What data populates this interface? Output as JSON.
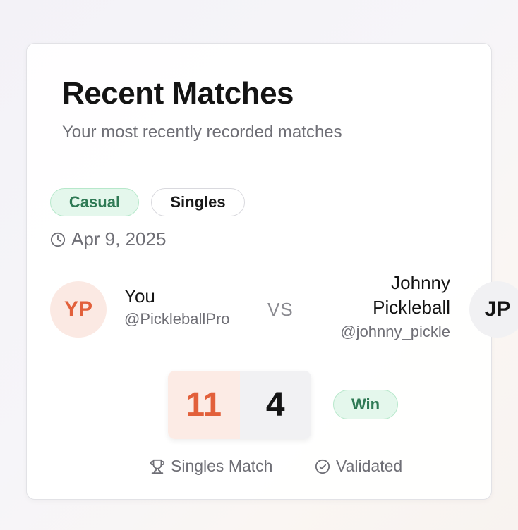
{
  "header": {
    "title": "Recent Matches",
    "subtitle": "Your most recently recorded matches"
  },
  "match": {
    "tags": [
      {
        "label": "Casual",
        "icon": "none"
      },
      {
        "label": "Singles",
        "icon": "none"
      }
    ],
    "date": "Apr 9, 2025",
    "date_icon": "clock-icon",
    "vs_label": "VS",
    "player": {
      "initials": "YP",
      "name": "You",
      "handle": "@PickleballPro"
    },
    "opponent": {
      "initials": "JP",
      "name_line1": "Johnny",
      "name_line2": "Pickleball",
      "handle": "@johnny_pickle"
    },
    "score": {
      "player": "11",
      "opponent": "4"
    },
    "result": "Win",
    "match_type": "Singles Match",
    "match_type_icon": "trophy-icon",
    "status": "Validated",
    "status_icon": "check-circle-icon"
  },
  "colors": {
    "accent_orange": "#e2603b",
    "success_green": "#2f7a55",
    "muted_text": "#6f6f76"
  }
}
